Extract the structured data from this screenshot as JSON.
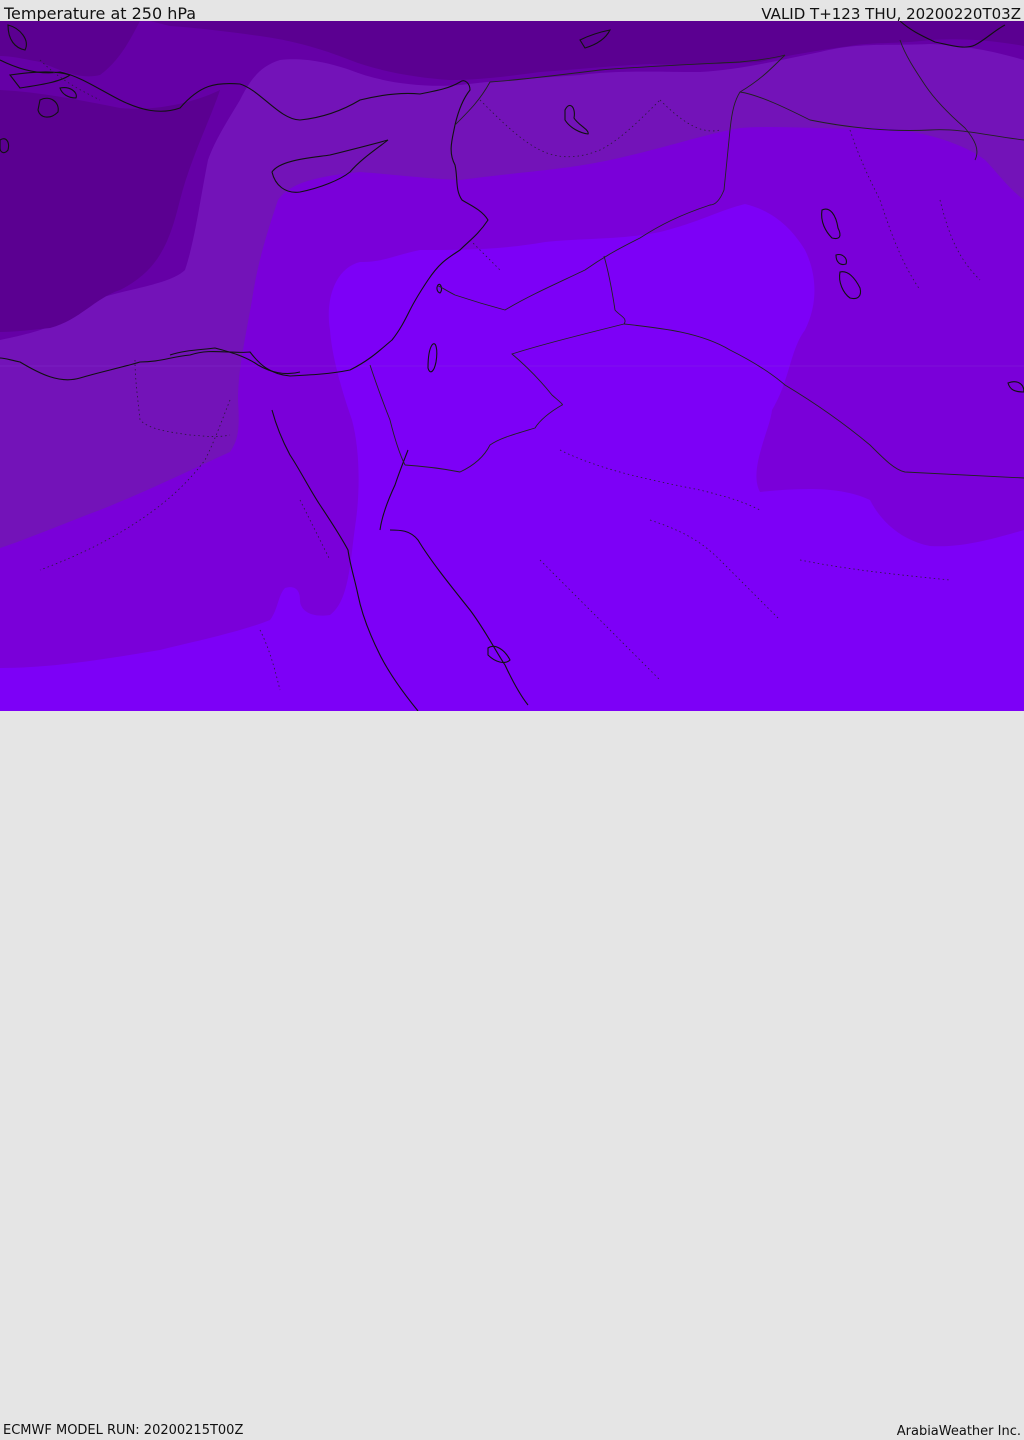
{
  "header": {
    "title": "Temperature at 250 hPa",
    "valid": "VALID T+123 THU, 20200220T03Z"
  },
  "footer": {
    "model_run": "ECMWF MODEL RUN: 20200215T00Z",
    "credit": "ArabiaWeather Inc."
  },
  "palette": {
    "band_coldest": "#5b0091",
    "band_cold": "#6500a6",
    "band_mid": "#7313b8",
    "band_warm": "#7a00d9",
    "band_warmest": "#7d00f7",
    "coastline": "#111111",
    "border": "#222222"
  }
}
